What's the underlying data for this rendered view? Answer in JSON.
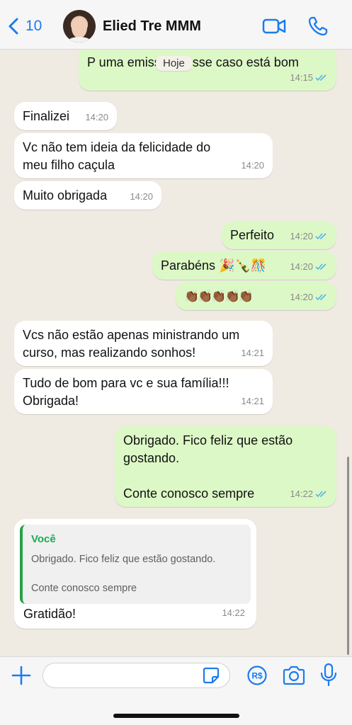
{
  "header": {
    "back_count": "10",
    "contact_name": "Elied Tre MMM"
  },
  "chat": {
    "date_label": "Hoje",
    "messages": [
      {
        "dir": "out",
        "text": "P uma emissão nesse caso está bom",
        "time": "14:15",
        "read": true
      },
      {
        "dir": "in",
        "text": "Finalizei",
        "time": "14:20"
      },
      {
        "dir": "in",
        "text": "Vc não tem ideia da felicidade do meu filho caçula",
        "time": "14:20"
      },
      {
        "dir": "in",
        "text": "Muito obrigada",
        "time": "14:20"
      },
      {
        "dir": "out",
        "text": "Perfeito",
        "time": "14:20",
        "read": true
      },
      {
        "dir": "out",
        "text": "Parabéns 🎉🍾🎊",
        "time": "14:20",
        "read": true
      },
      {
        "dir": "out",
        "text": "👏🏾👏🏾👏🏾👏🏾👏🏾",
        "time": "14:20",
        "read": true
      },
      {
        "dir": "in",
        "text": "Vcs não estão apenas ministrando um curso, mas realizando sonhos!",
        "time": "14:21"
      },
      {
        "dir": "in",
        "text": "Tudo de bom para vc e sua família!!! Obrigada!",
        "time": "14:21"
      },
      {
        "dir": "out",
        "text_line1": "Obrigado. Fico feliz que estão gostando.",
        "text_line2": "Conte conosco sempre",
        "time": "14:22",
        "read": true
      },
      {
        "dir": "in",
        "quote_author": "Você",
        "quote_line1": "Obrigado. Fico feliz que estão gostando.",
        "quote_line2": "Conte conosco sempre",
        "text": "Gratidão!",
        "time": "14:22"
      }
    ]
  },
  "composer": {
    "value": "",
    "placeholder": ""
  },
  "colors": {
    "accent": "#1a7cf0",
    "outgoing_bubble": "#dcf8c6",
    "incoming_bubble": "#ffffff",
    "read_ticks": "#4fb6ec",
    "quote_author": "#1fa855"
  },
  "icons": [
    "chevron-left-icon",
    "video-call-icon",
    "phone-icon",
    "plus-icon",
    "sticker-icon",
    "pix-payment-icon",
    "camera-icon",
    "microphone-icon",
    "double-check-icon"
  ]
}
